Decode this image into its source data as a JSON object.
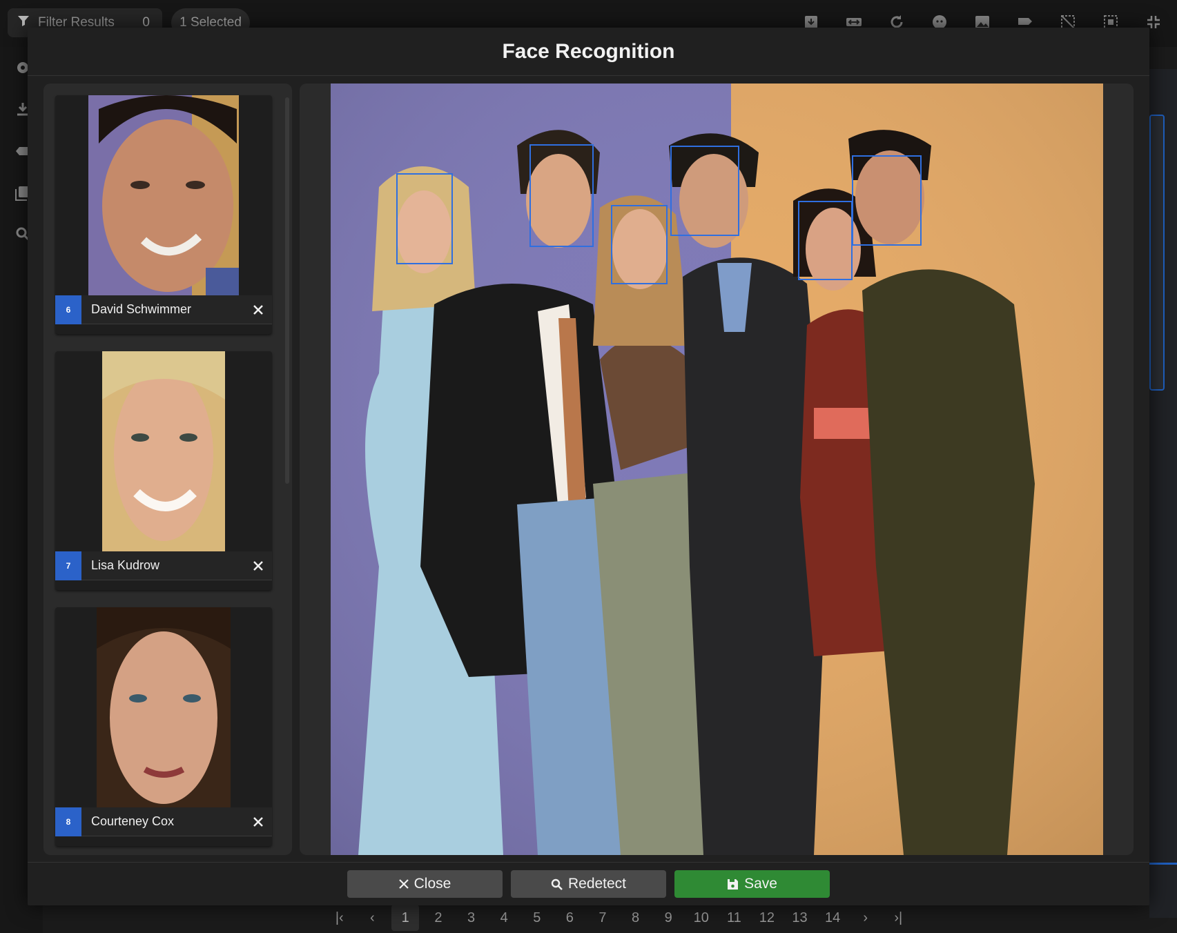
{
  "topbar": {
    "filter_label": "Filter Results",
    "filter_count": "0",
    "selected_label": "1 Selected",
    "icons": [
      "download-box-icon",
      "resize-icon",
      "refresh-icon",
      "face-icon",
      "image-icon",
      "tag-icon",
      "select-off-icon",
      "select-all-icon",
      "collapse-icon"
    ]
  },
  "leftnav": {
    "icons": [
      "gear-icon",
      "download-icon",
      "tag-icon",
      "images-icon",
      "search-icon"
    ]
  },
  "modal": {
    "title": "Face Recognition",
    "faces": [
      {
        "index": "6",
        "name": "David Schwimmer"
      },
      {
        "index": "7",
        "name": "Lisa Kudrow"
      },
      {
        "index": "8",
        "name": "Courteney Cox"
      }
    ],
    "buttons": {
      "close": "Close",
      "redetect": "Redetect",
      "save": "Save"
    }
  },
  "pager": {
    "pages": [
      "1",
      "2",
      "3",
      "4",
      "5",
      "6",
      "7",
      "8",
      "9",
      "10",
      "11",
      "12",
      "13",
      "14"
    ],
    "current": "1"
  },
  "colors": {
    "accent_blue": "#2b62c9",
    "save_green": "#2f8a34",
    "face_box": "#2f6fe0"
  }
}
